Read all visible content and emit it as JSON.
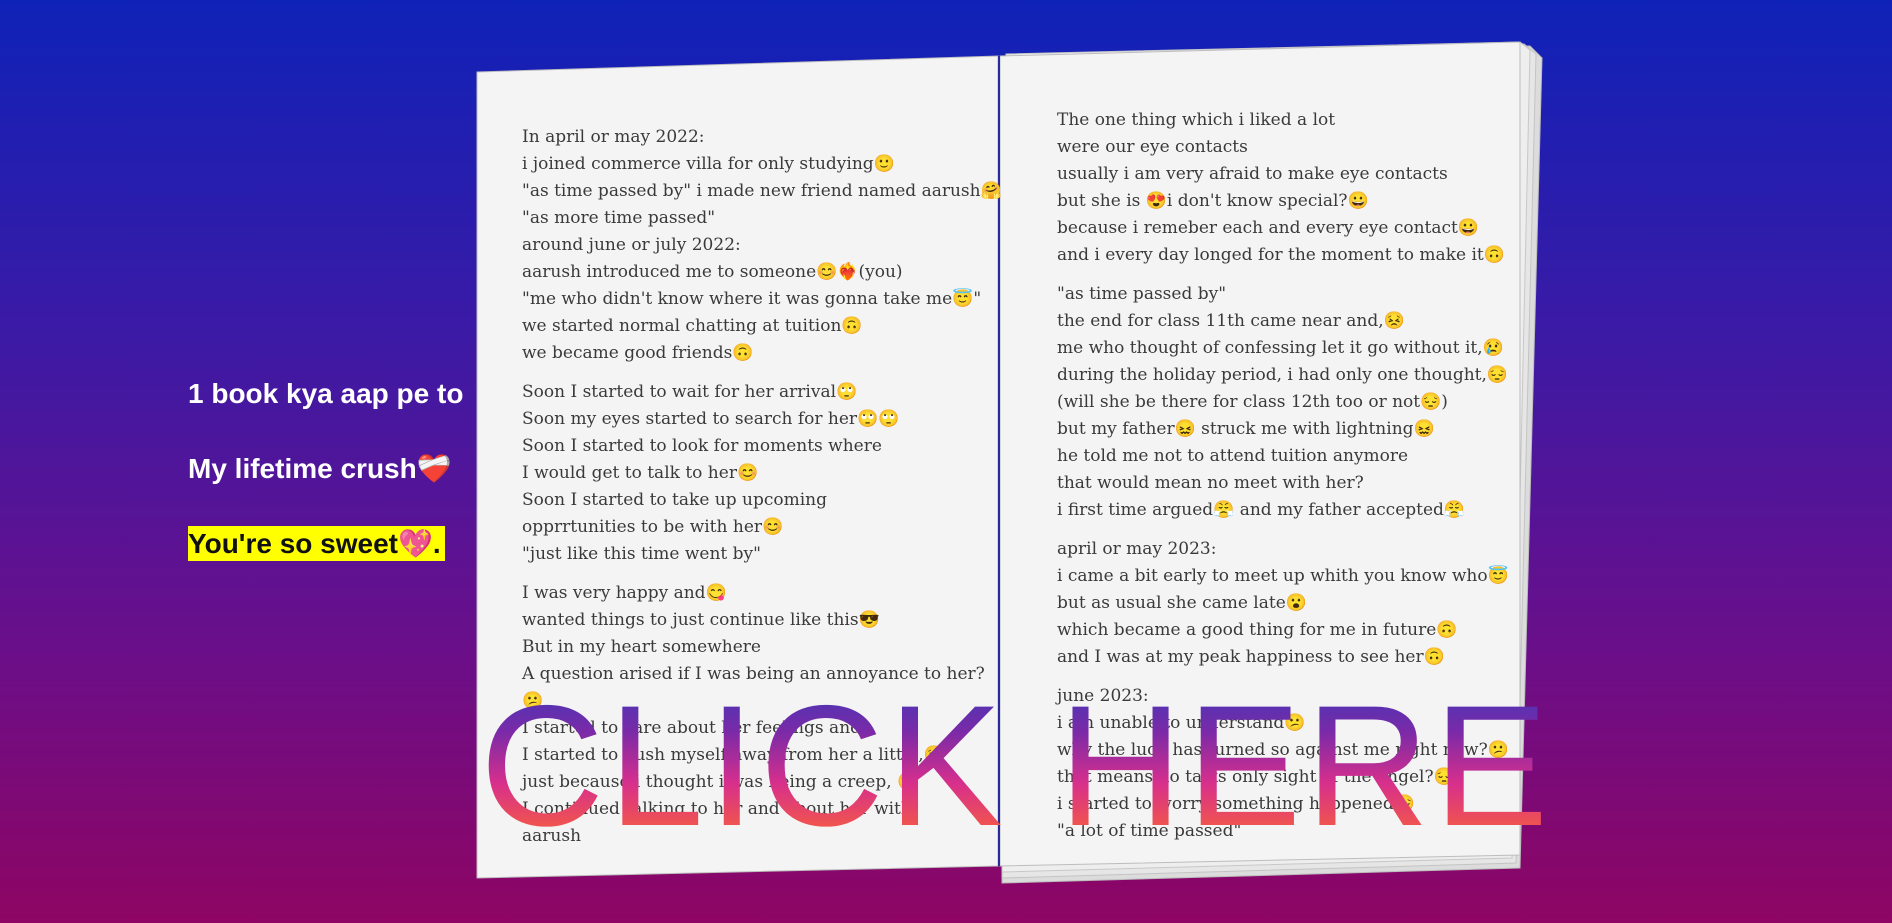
{
  "side": {
    "line1": "1 book kya aap pe to",
    "line2": "My lifetime crush❤️‍🩹",
    "line3": "You're so sweet💖."
  },
  "book": {
    "left_page": [
      "In april or may 2022:",
      "i joined commerce villa for only studying🙂",
      "\"as time passed by\" i made new friend named aarush🤗",
      "\"as more time passed\"",
      "around june or july 2022:",
      "aarush introduced me to someone😊❤️‍🔥(you)",
      "\"me who didn't know where it was gonna take me😇\"",
      "we started normal chatting at tuition🙃",
      "we became good friends🙃",
      "",
      "Soon I started to wait for her arrival🙄",
      "Soon my eyes started to search for her🙄🙄",
      "Soon I started to look for moments where",
      "I would get to talk to her😊",
      "Soon I started to take up upcoming",
      "opprrtunities to be with her😊",
      "\"just like this time went by\"",
      "",
      "I was very happy and😋",
      "wanted things to just continue like this😎",
      "But in my heart somewhere",
      "A question arised if I was being an annoyance to her?",
      "😕",
      "I started to care about her feelings and",
      "I started to push myself away from her a little,😣",
      "just because i thought i was being a creep, 😣",
      "I continued talking to her and about her with",
      "aarush"
    ],
    "right_page": [
      "The one thing which i liked a lot",
      "were our eye contacts",
      "usually i am very afraid to make eye contacts",
      "but she is 😍i don't know special?😀",
      "because i remeber each and every eye contact😀",
      "and i every day longed for the moment to make it🙃",
      "",
      "\"as time passed by\"",
      "the end for class 11th came near and,😣",
      "me who thought of confessing let it go without it,😢",
      "during the holiday period, i had only one thought,😔",
      "(will she be there for class 12th too or not😔)",
      "but my father😖 struck me with lightning😖",
      "he told me not to attend tuition anymore",
      "that would mean no meet with her?",
      "i first time argued😤 and my father accepted😤",
      "",
      "april or may 2023:",
      "i came a bit early to meet up whith you know who😇",
      "but as usual she came late😮",
      "which became a good thing for me in future🙃",
      "and I was at my peak happiness to see her🙃",
      "",
      "june 2023:",
      "i am unable to understand😕",
      "why the luck has turned so against me right now?😕",
      "that means no talks only sight of the angel?😔",
      "i started to worry something happened😔",
      "\"a lot of time passed\""
    ]
  },
  "cta": {
    "label": "CLICK HERE"
  }
}
